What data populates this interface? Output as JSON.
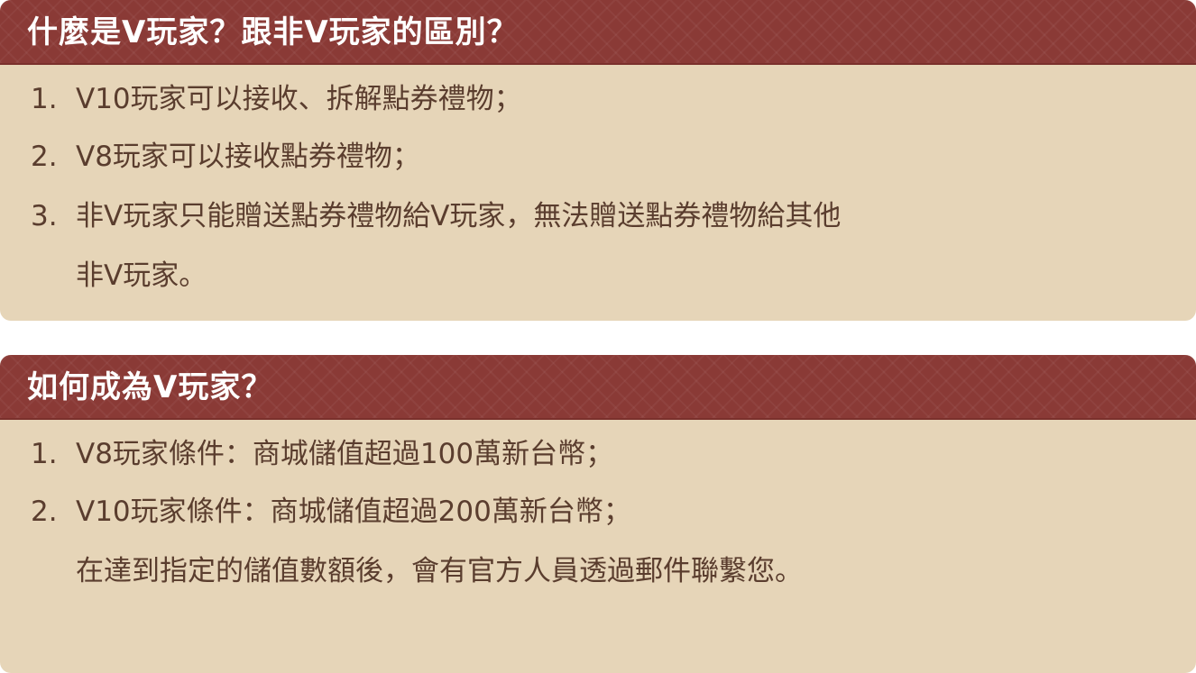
{
  "sections": [
    {
      "title": "什麼是V玩家？跟非V玩家的區別？",
      "items": [
        {
          "number": "1.",
          "line1": "V10玩家可以接收、拆解點券禮物；",
          "line2": ""
        },
        {
          "number": "2.",
          "line1": "V8玩家可以接收點券禮物；",
          "line2": ""
        },
        {
          "number": "3.",
          "line1": "非V玩家只能贈送點券禮物給V玩家，無法贈送點券禮物給其他",
          "line2": "非V玩家。"
        }
      ]
    },
    {
      "title": "如何成為V玩家？",
      "items": [
        {
          "number": "1.",
          "line1": "V8玩家條件：商城儲值超過100萬新台幣；",
          "line2": ""
        },
        {
          "number": "2.",
          "line1": "V10玩家條件：商城儲值超過200萬新台幣；",
          "line2": "在達到指定的儲值數額後，會有官方人員透過郵件聯繫您。"
        }
      ]
    }
  ],
  "colors": {
    "header_bg": "#8a3a36",
    "panel_bg": "#e6d5b8",
    "title_text": "#ffffff",
    "body_text": "#5a3d2e"
  }
}
